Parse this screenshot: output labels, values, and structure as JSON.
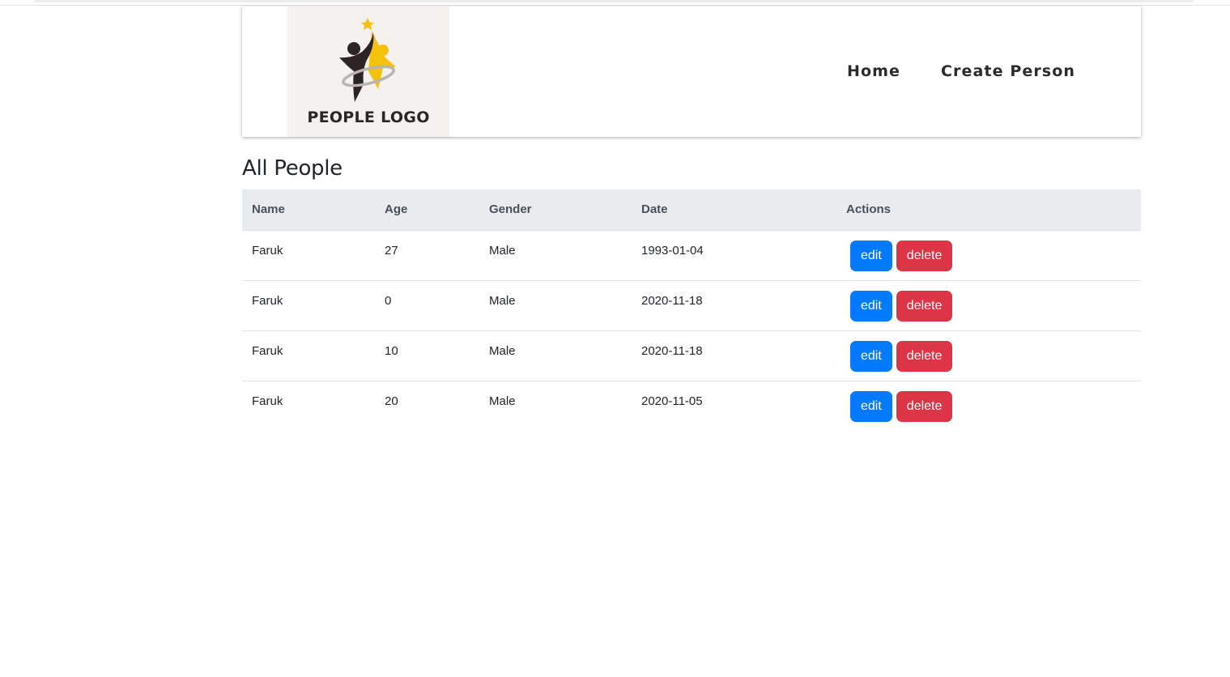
{
  "header": {
    "logo_text": "PEOPLE LOGO",
    "nav": [
      {
        "label": "Home"
      },
      {
        "label": "Create Person"
      }
    ]
  },
  "main": {
    "title": "All People",
    "table": {
      "columns": [
        "Name",
        "Age",
        "Gender",
        "Date",
        "Actions"
      ],
      "rows": [
        {
          "name": "Faruk",
          "age": "27",
          "gender": "Male",
          "date": "1993-01-04",
          "edit": "edit",
          "delete": "delete"
        },
        {
          "name": "Faruk",
          "age": "0",
          "gender": "Male",
          "date": "2020-11-18",
          "edit": "edit",
          "delete": "delete"
        },
        {
          "name": "Faruk",
          "age": "10",
          "gender": "Male",
          "date": "2020-11-18",
          "edit": "edit",
          "delete": "delete"
        },
        {
          "name": "Faruk",
          "age": "20",
          "gender": "Male",
          "date": "2020-11-05",
          "edit": "edit",
          "delete": "delete"
        }
      ]
    }
  },
  "colors": {
    "edit_button": "#007bff",
    "delete_button": "#dc3545",
    "table_header_bg": "#e9ecef",
    "logo_yellow": "#f4c20d",
    "logo_dark": "#2b2523"
  }
}
